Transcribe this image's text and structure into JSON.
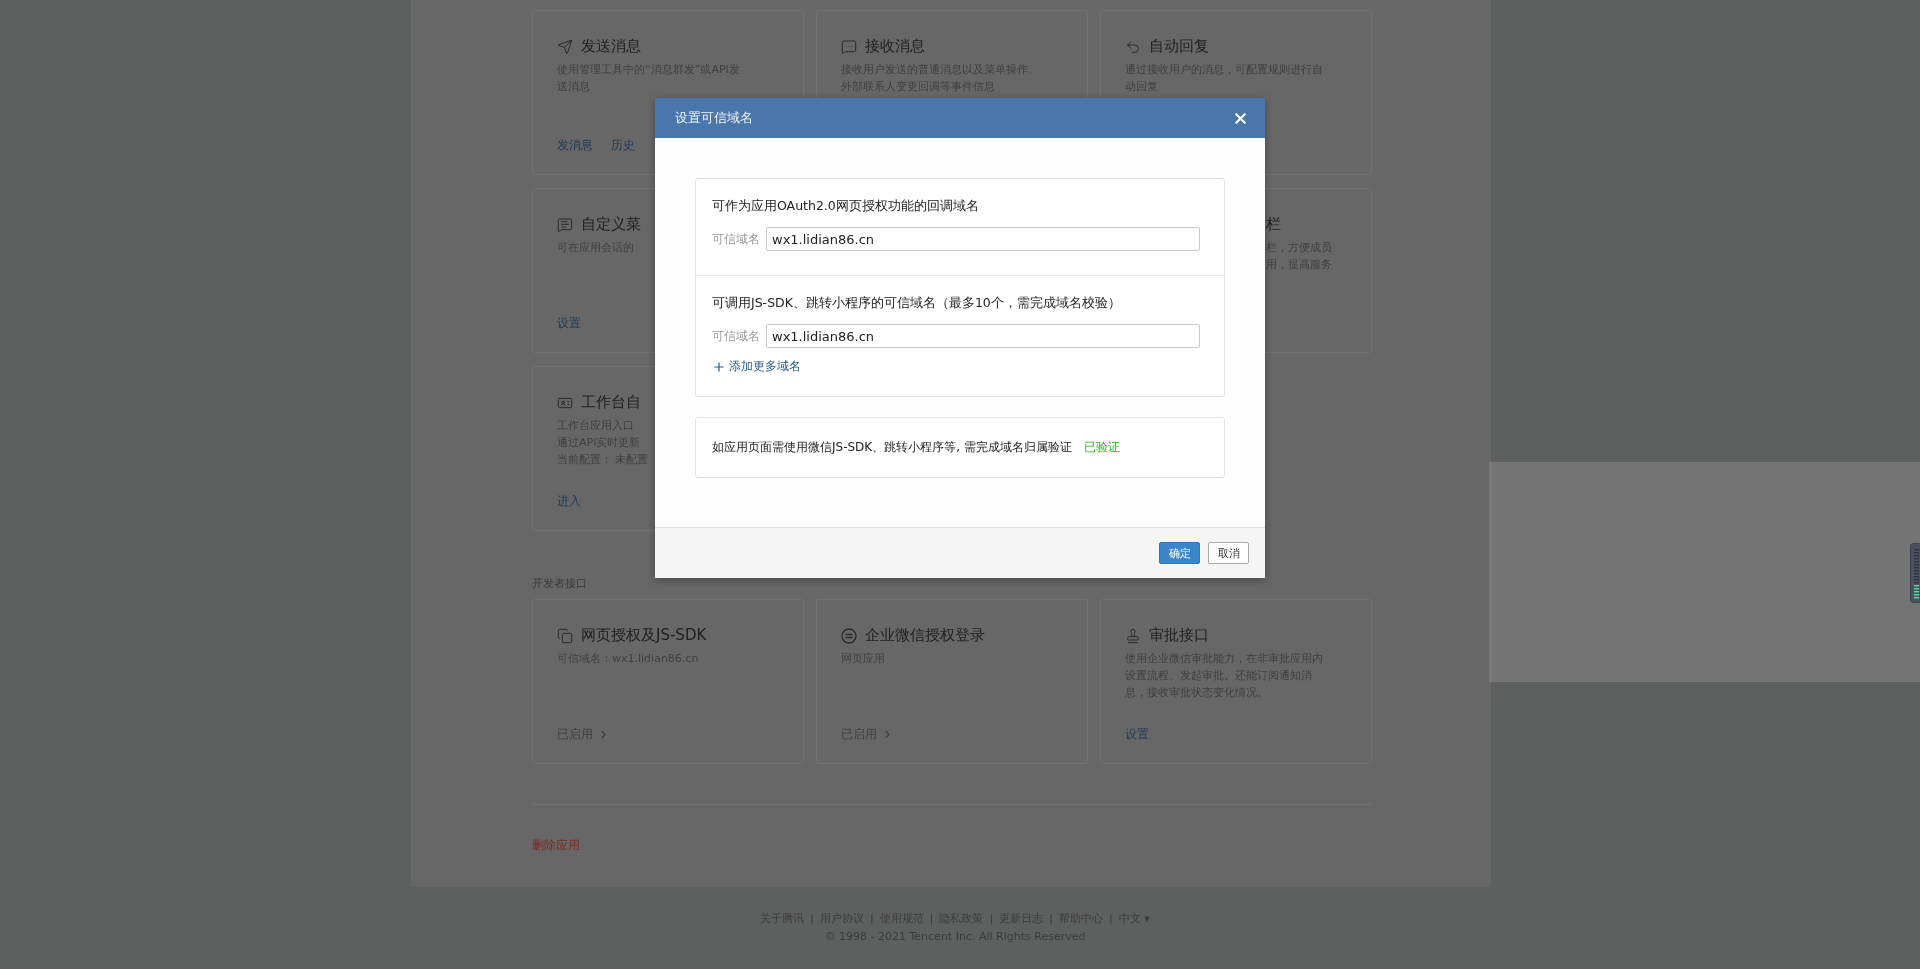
{
  "app_cards": [
    {
      "kind": "full",
      "title": "发送消息",
      "lines": [
        "使用管理工具中的“消息群发”或API发",
        "送消息"
      ],
      "links": [
        "发消息",
        "历史"
      ]
    },
    {
      "kind": "full",
      "title": "接收消息",
      "lines": [
        "接收用户发送的普通消息以及菜单操作、",
        "外部联系人变更回调等事件信息"
      ]
    },
    {
      "kind": "full",
      "title": "自动回复",
      "lines": [
        "通过接收用户的消息，可配置规则进行自",
        "动回复"
      ]
    },
    {
      "kind": "cut-right",
      "title": "自定义菜",
      "lines": [
        "可在应用会话的"
      ],
      "links": [
        "设置"
      ]
    },
    {
      "kind": "hidden"
    },
    {
      "kind": "cut-left",
      "title": "栏",
      "lines": [
        "栏，方便成员",
        "用，提高服务"
      ]
    },
    {
      "kind": "cut-right",
      "title": "工作台自",
      "lines": [
        "工作台应用入口",
        "通过API实时更新",
        "当前配置： 未配置"
      ],
      "links": [
        "进入"
      ]
    }
  ],
  "developer": {
    "label": "开发者接口",
    "cards": [
      {
        "title": "网页授权及JS-SDK",
        "lines": [
          "可信域名：wx1.lidian86.cn"
        ],
        "action": {
          "kind": "status",
          "label": "已启用"
        }
      },
      {
        "title": "企业微信授权登录",
        "lines": [
          "网页应用"
        ],
        "action": {
          "kind": "status",
          "label": "已启用"
        }
      },
      {
        "title": "审批接口",
        "lines": [
          "使用企业微信审批能力，在非审批应用内",
          "设置流程、发起审批。还能订阅通知消",
          "息，接收审批状态变化情况。"
        ],
        "action": {
          "kind": "link",
          "label": "设置"
        }
      }
    ]
  },
  "delete_link": "删除应用",
  "footer": {
    "links": [
      {
        "label": "关于腾讯",
        "separator": "|"
      },
      {
        "label": "用户协议",
        "separator": "|"
      },
      {
        "label": "使用规范",
        "separator": "|"
      },
      {
        "label": "隐私政策",
        "separator": "|"
      },
      {
        "label": "更新日志",
        "separator": "|"
      },
      {
        "label": "帮助中心",
        "separator": "|"
      }
    ],
    "language": "中文",
    "language_caret": "▾",
    "copyright": "© 1998 - 2021 Tencent Inc. All Rights Reserved"
  },
  "dialog": {
    "title": "设置可信域名",
    "sections": [
      {
        "heading": "可作为应用OAuth2.0网页授权功能的回调域名",
        "field_label": "可信域名",
        "domains": [
          "wx1.lidian86.cn"
        ]
      },
      {
        "heading": "可调用JS-SDK、跳转小程序的可信域名（最多10个，需完成域名校验）",
        "field_label": "可信域名",
        "domains": [
          "wx1.lidian86.cn"
        ],
        "add_link": "添加更多域名"
      }
    ],
    "verify": {
      "text": "如应用页面需使用微信JS-SDK、跳转小程序等, 需完成域名归属验证",
      "status": "已验证",
      "verified": true
    },
    "buttons": [
      {
        "kind": "primary",
        "label": "确定"
      },
      {
        "kind": "default",
        "label": "取消"
      }
    ]
  }
}
